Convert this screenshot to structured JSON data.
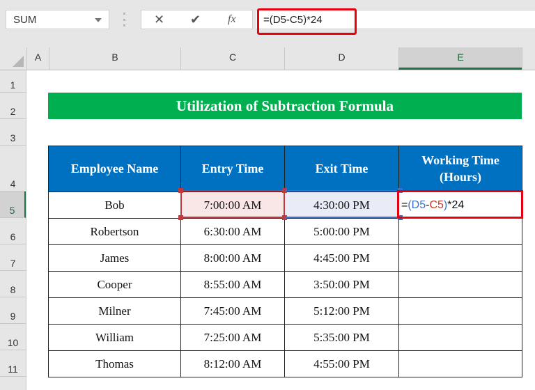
{
  "formula_bar": {
    "name_box": "SUM",
    "cancel_icon": "✕",
    "enter_icon": "✔",
    "fx_label": "fx",
    "formula": "=(D5-C5)*24"
  },
  "columns": [
    "A",
    "B",
    "C",
    "D",
    "E"
  ],
  "selected_column": "E",
  "rows": [
    "1",
    "2",
    "3",
    "4",
    "5",
    "6",
    "7",
    "8",
    "9",
    "10",
    "11"
  ],
  "selected_row": "5",
  "sheet": {
    "title": "Utilization of Subtraction Formula",
    "headers": [
      "Employee Name",
      "Entry Time",
      "Exit Time",
      "Working Time (Hours)"
    ],
    "header_line1": "Working Time",
    "header_line2": "(Hours)",
    "records": [
      {
        "name": "Bob",
        "entry": "7:00:00 AM",
        "exit": "4:30:00 PM",
        "hours": "=(D5-C5)*24"
      },
      {
        "name": "Robertson",
        "entry": "6:30:00 AM",
        "exit": "5:00:00 PM",
        "hours": ""
      },
      {
        "name": "James",
        "entry": "8:00:00 AM",
        "exit": "4:45:00 PM",
        "hours": ""
      },
      {
        "name": "Cooper",
        "entry": "8:55:00 AM",
        "exit": "3:50:00 PM",
        "hours": ""
      },
      {
        "name": "Milner",
        "entry": "7:45:00 AM",
        "exit": "5:12:00 PM",
        "hours": ""
      },
      {
        "name": "William",
        "entry": "7:25:00 AM",
        "exit": "5:35:00 PM",
        "hours": ""
      },
      {
        "name": "Thomas",
        "entry": "8:12:00 AM",
        "exit": "4:55:00 PM",
        "hours": ""
      }
    ],
    "edit_formula_parts": {
      "eq": "=",
      "open": "(",
      "d5": "D5",
      "minus": "-",
      "c5": "C5",
      "close": ")",
      "rest": "*24"
    }
  },
  "colors": {
    "title_bg": "#00b050",
    "header_bg": "#0070c0",
    "highlight": "#e8000c",
    "ref_c": "#c0393e",
    "ref_d": "#3d6fc5"
  }
}
